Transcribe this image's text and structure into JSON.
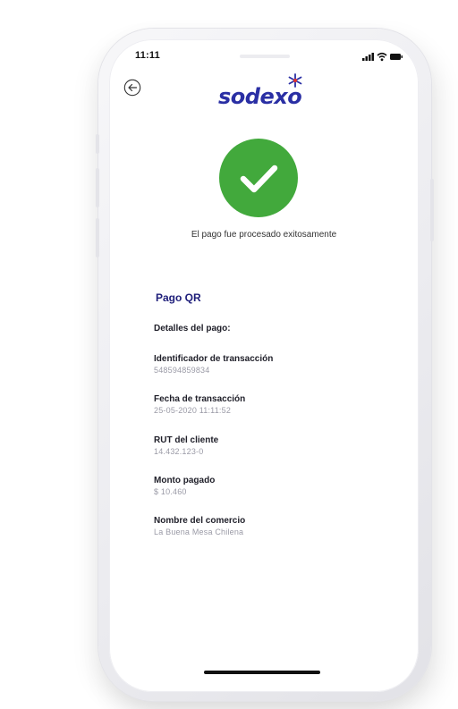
{
  "status_bar": {
    "time": "11:11",
    "icons": [
      "signal-icon",
      "wifi-icon",
      "battery-icon"
    ]
  },
  "header": {
    "back_icon": "back-arrow-icon",
    "logo_text": "sodexo"
  },
  "success": {
    "icon": "checkmark-icon",
    "message": "El pago fue procesado exitosamente"
  },
  "receipt": {
    "section_title": "Pago QR",
    "details_title": "Detalles del pago:",
    "fields": [
      {
        "label": "Identificador de transacción",
        "value": "548594859834"
      },
      {
        "label": "Fecha de transacción",
        "value": "25-05-2020 11:11:52"
      },
      {
        "label": "RUT del cliente",
        "value": "14.432.123-0"
      },
      {
        "label": "Monto pagado",
        "value": "$ 10.460"
      },
      {
        "label": "Nombre del comercio",
        "value": "La Buena Mesa Chilena"
      }
    ]
  },
  "colors": {
    "brand_blue": "#2a2fa4",
    "brand_red": "#e4312b",
    "success_green": "#42a93c",
    "label_dark": "#1e1e28",
    "value_gray": "#9a9aa6"
  }
}
